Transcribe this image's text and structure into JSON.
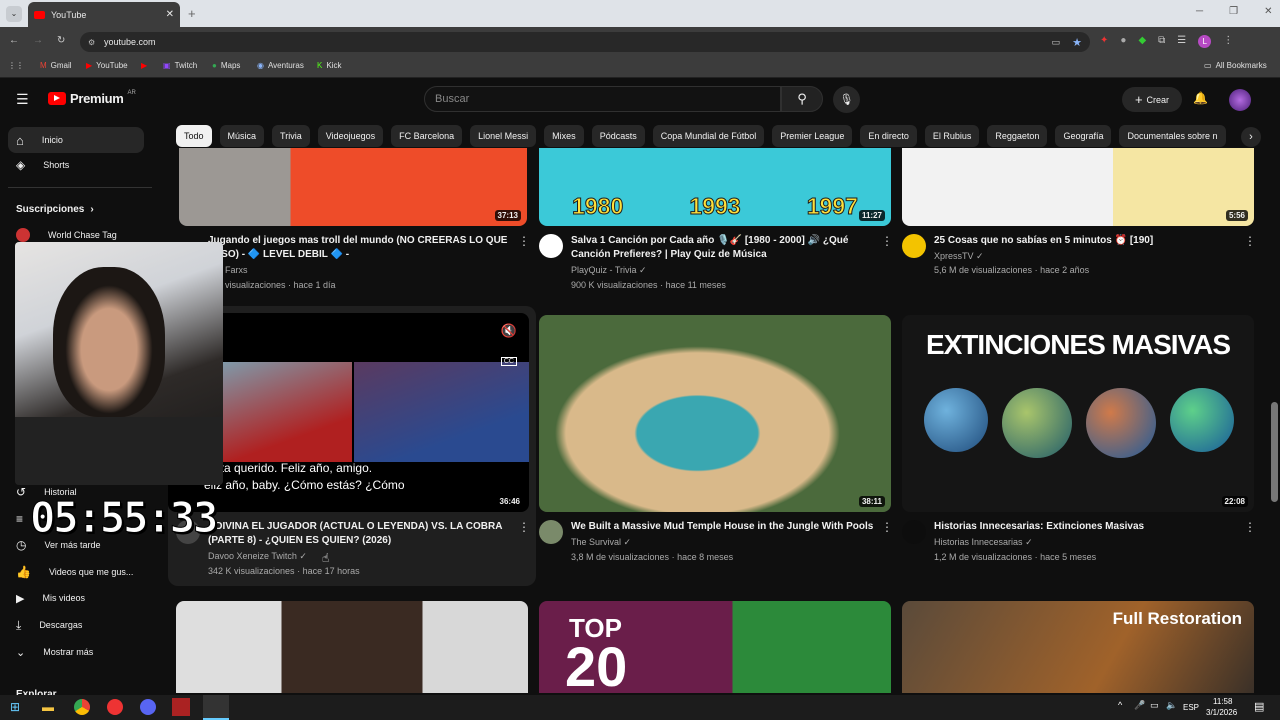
{
  "browser": {
    "tab_title": "YouTube",
    "url": "youtube.com",
    "bookmarks": [
      "Gmail",
      "YouTube",
      "Twitch",
      "Maps",
      "Aventuras",
      "Kick"
    ],
    "all_bookmarks": "All Bookmarks"
  },
  "header": {
    "logo": "Premium",
    "region": "AR",
    "search_placeholder": "Buscar",
    "create_label": "Crear"
  },
  "chips": [
    "Todo",
    "Música",
    "Trivia",
    "Videojuegos",
    "FC Barcelona",
    "Lionel Messi",
    "Mixes",
    "Pódcasts",
    "Copa Mundial de Fútbol",
    "Premier League",
    "En directo",
    "El Rubius",
    "Reggaeton",
    "Geografía",
    "Documentales sobre n"
  ],
  "sidebar": {
    "home": "Inicio",
    "shorts": "Shorts",
    "subscriptions": "Suscripciones",
    "sub_channel": "World Chase Tag",
    "history": "Historial",
    "watch_later": "Ver más tarde",
    "liked": "Videos que me gus...",
    "my_videos": "Mis videos",
    "downloads": "Descargas",
    "show_more": "Mostrar más",
    "explore": "Explorar"
  },
  "videos": [
    {
      "title": "Jugando el juegos mas troll del mundo (NO CREERAS LO QUE PASO) - 🔷 LEVEL DEBIL 🔷 -",
      "channel": "Farxs",
      "views": "visualizaciones",
      "age": "hace 1 día",
      "duration": "37:13"
    },
    {
      "title": "Salva 1 Canción por Cada año 🎙️🎸 [1980 - 2000] 🔊 ¿Qué Canción Prefieres? | Play Quiz de Música",
      "channel": "PlayQuiz - Trivia",
      "views": "900 K visualizaciones",
      "age": "hace 11 meses",
      "duration": "11:27"
    },
    {
      "title": "25 Cosas que no sabías en 5 minutos ⏰ [190]",
      "channel": "XpressTV",
      "views": "5,6 M de visualizaciones",
      "age": "hace 2 años",
      "duration": "5:56"
    },
    {
      "title": "ADIVINA EL JUGADOR (ACTUAL O LEYENDA) VS. LA COBRA (PARTE 8) - ¿QUIEN ES QUIEN? (2026)",
      "channel": "Davoo Xeneize Twitch",
      "views": "342 K visualizaciones",
      "age": "hace 17 horas",
      "duration": "36:46",
      "caption1": "rita querido. Feliz año, amigo.",
      "caption2": "eliz año, baby. ¿Cómo estás? ¿Cómo"
    },
    {
      "title": "We Built a Massive Mud Temple House in the Jungle With Pools",
      "channel": "The Survival",
      "views": "3,8 M de visualizaciones",
      "age": "hace 8 meses",
      "duration": "38:11"
    },
    {
      "title": "Historias Innecesarias: Extinciones Masivas",
      "channel": "Historias Innecesarias",
      "views": "1,2 M de visualizaciones",
      "age": "hace 5 meses",
      "duration": "22:08",
      "thumb_text": "EXTINCIONES MASIVAS"
    }
  ],
  "bottom_thumbs": {
    "top": "TOP",
    "twenty": "20",
    "restoration": "Full Restoration"
  },
  "quiz_years": [
    "1980",
    "1993",
    "1997"
  ],
  "overlay": {
    "timer": "05:55:33"
  },
  "taskbar": {
    "lang": "ESP",
    "time": "11:58",
    "date": "3/1/2026"
  }
}
